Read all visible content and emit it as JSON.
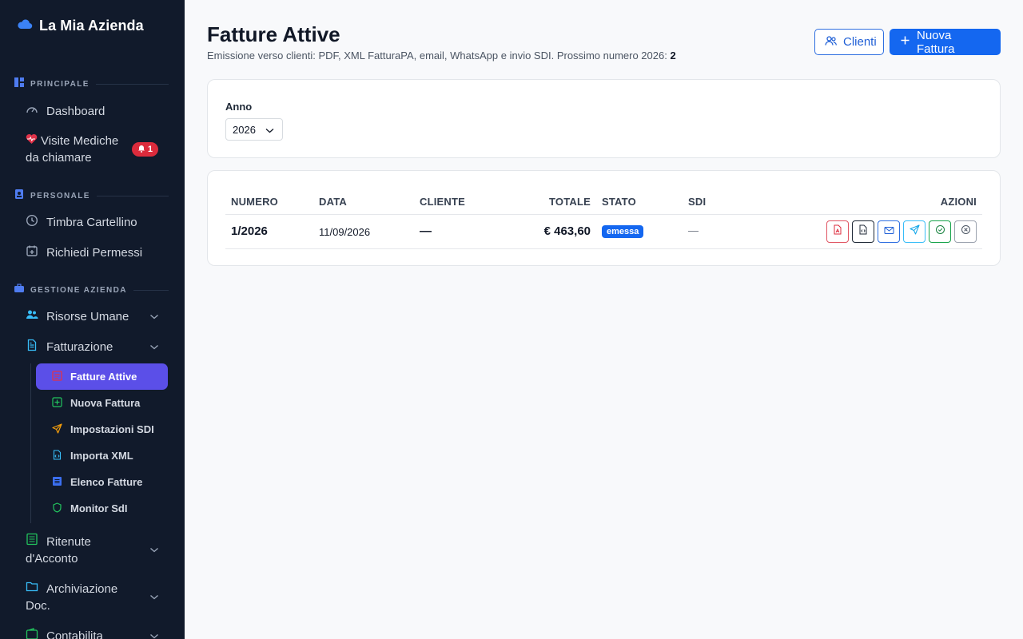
{
  "sidebar": {
    "brand": "La Mia Azienda",
    "sections": {
      "principale": "PRINCIPALE",
      "personale": "PERSONALE",
      "gestione": "GESTIONE AZIENDA"
    },
    "items": {
      "dashboard": "Dashboard",
      "visite_line1": "Visite Mediche",
      "visite_line2": "da chiamare",
      "visite_badge": "1",
      "timbra": "Timbra Cartellino",
      "permessi": "Richiedi Permessi",
      "risorse": "Risorse Umane",
      "fatturazione": "Fatturazione",
      "ritenute_line1": "Ritenute",
      "ritenute_line2": "d'Acconto",
      "archiviazione_line1": "Archiviazione",
      "archiviazione_line2": "Doc.",
      "contabilita": "Contabilita"
    },
    "sub_items": {
      "fatture_attive": "Fatture Attive",
      "nuova_fattura": "Nuova Fattura",
      "impostazioni_sdi": "Impostazioni SDI",
      "importa_xml": "Importa XML",
      "elenco_fatture": "Elenco Fatture",
      "monitor_sdi": "Monitor SdI"
    }
  },
  "header": {
    "title": "Fatture Attive",
    "subtitle": "Emissione verso clienti: PDF, XML FatturaPA, email, WhatsApp e invio SDI. Prossimo numero 2026:",
    "next_number": "2",
    "clienti_label": "Clienti",
    "nuova_label": "Nuova Fattura"
  },
  "filter": {
    "label": "Anno",
    "year": "2026"
  },
  "table": {
    "columns": {
      "numero": "NUMERO",
      "data": "DATA",
      "cliente": "CLIENTE",
      "totale": "TOTALE",
      "stato": "STATO",
      "sdi": "SDI",
      "azioni": "AZIONI"
    },
    "rows": [
      {
        "numero": "1/2026",
        "data": "11/09/2026",
        "cliente": "—",
        "totale": "€ 463,60",
        "stato": "emessa",
        "sdi": "—"
      }
    ]
  },
  "colors": {
    "sidebar_bg": "#111a2b",
    "active_item": "#5b4fe8",
    "primary": "#1467f0",
    "alert": "#dc2b3c"
  }
}
